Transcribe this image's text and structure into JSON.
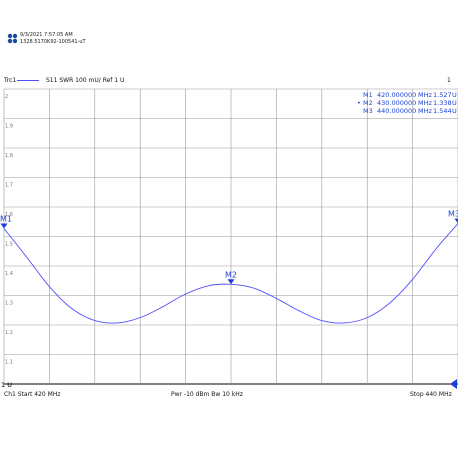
{
  "header": {
    "timestamp": "9/3/2021 7:57:05 AM",
    "instrument_id": "1328.5170K92-100541-uT",
    "trace_label": "Trc1",
    "trace_info": "S11  SWR  100 mU/ Ref 1 U",
    "channel_number": "1"
  },
  "markers": [
    {
      "id": "M1",
      "active": false,
      "freq": "420.000000",
      "freq_unit": "MHz",
      "value": "1.527",
      "value_unit": "U"
    },
    {
      "id": "M2",
      "active": true,
      "freq": "430.000000",
      "freq_unit": "MHz",
      "value": "1.338",
      "value_unit": "U"
    },
    {
      "id": "M3",
      "active": false,
      "freq": "440.000000",
      "freq_unit": "MHz",
      "value": "1.544",
      "value_unit": "U"
    }
  ],
  "footer": {
    "start": "Ch1  Start  420 MHz",
    "power": "Pwr  -10 dBm  Bw  10 kHz",
    "stop": "Stop  440 MHz"
  },
  "colors": {
    "trace": "#5050ff",
    "marker": "#1a3fd6",
    "grid": "#9a9a9a"
  },
  "chart_data": {
    "type": "line",
    "title": "",
    "xlabel": "",
    "ylabel": "",
    "xlim": [
      420,
      440
    ],
    "ylim": [
      1,
      2
    ],
    "grid": true,
    "y_ticks": [
      "2",
      "1.9",
      "1.8",
      "1.7",
      "1.6",
      "1.5",
      "1.4",
      "1.3",
      "1.2",
      "1.1",
      "1 U"
    ],
    "series": [
      {
        "name": "Trc1",
        "x": [
          420,
          421,
          422,
          423,
          424,
          425,
          426,
          427,
          428,
          429,
          430,
          431,
          432,
          433,
          434,
          435,
          436,
          437,
          438,
          439,
          440
        ],
        "y": [
          1.527,
          1.43,
          1.33,
          1.255,
          1.215,
          1.207,
          1.225,
          1.262,
          1.305,
          1.333,
          1.338,
          1.325,
          1.29,
          1.248,
          1.215,
          1.207,
          1.225,
          1.275,
          1.355,
          1.455,
          1.544
        ]
      }
    ],
    "marker_labels": [
      {
        "id": "M1",
        "x": 420,
        "y": 1.527
      },
      {
        "id": "M2",
        "x": 430,
        "y": 1.338
      },
      {
        "id": "M3",
        "x": 440,
        "y": 1.544
      }
    ]
  }
}
